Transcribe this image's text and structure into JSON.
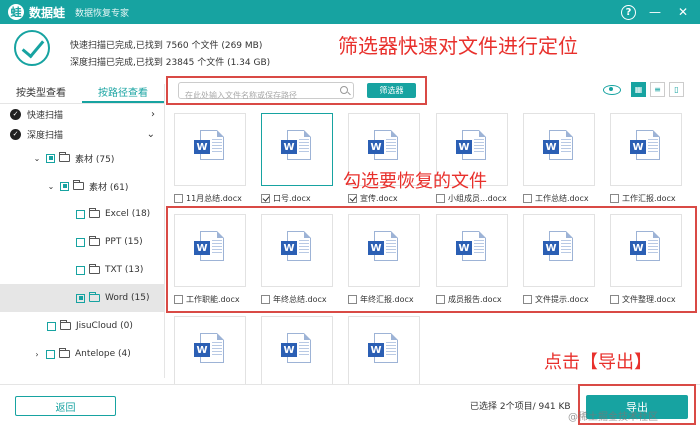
{
  "app": {
    "name": "数据蛙",
    "subtitle": "数据恢复专家",
    "logo_char": "蛙"
  },
  "window_controls": {
    "help": "?",
    "minimize": "—",
    "close": "✕"
  },
  "scan": {
    "quick": "快速扫描已完成,已找到 7560 个文件 (269 MB)",
    "deep": "深度扫描已完成,已找到 23845 个文件 (1.34 GB)"
  },
  "annotations": {
    "filter": "筛选器快速对文件进行定位",
    "check": "勾选要恢复的文件",
    "export": "点击【导出】"
  },
  "left_panel": {
    "tabs": [
      {
        "label": "按类型查看",
        "active": false
      },
      {
        "label": "按路径查看",
        "active": true
      }
    ],
    "scan_nodes": [
      {
        "label": "快速扫描",
        "chevron": "›"
      },
      {
        "label": "深度扫描",
        "chevron": "⌄"
      }
    ],
    "tree": [
      {
        "label": "素材 (75)",
        "caret": "⌄",
        "check": "part"
      },
      {
        "label": "素材 (61)",
        "caret": "⌄",
        "check": "part"
      },
      {
        "label": "Excel (18)",
        "caret": "",
        "check": "none"
      },
      {
        "label": "PPT (15)",
        "caret": "",
        "check": "none"
      },
      {
        "label": "TXT (13)",
        "caret": "",
        "check": "none"
      },
      {
        "label": "Word (15)",
        "caret": "",
        "check": "part"
      },
      {
        "label": "JisuCloud (0)",
        "caret": "",
        "check": "none"
      },
      {
        "label": "Antelope (4)",
        "caret": "›",
        "check": "none"
      }
    ]
  },
  "toolbar": {
    "search_placeholder": "在此处输入文件名称或保存路径",
    "filter_label": "筛选器",
    "view_grid": "▦",
    "view_list": "≡",
    "view_detail": "▯"
  },
  "files": [
    {
      "name": "11月总结.docx",
      "checked": false
    },
    {
      "name": "口号.docx",
      "checked": true
    },
    {
      "name": "宣传.docx",
      "checked": true
    },
    {
      "name": "小组成员...docx",
      "checked": false
    },
    {
      "name": "工作总结.docx",
      "checked": false
    },
    {
      "name": "工作汇报.docx",
      "checked": false
    },
    {
      "name": "工作职能.docx",
      "checked": false
    },
    {
      "name": "年终总结.docx",
      "checked": false
    },
    {
      "name": "年终汇报.docx",
      "checked": false
    },
    {
      "name": "成员报告.docx",
      "checked": false
    },
    {
      "name": "文件提示.docx",
      "checked": false
    },
    {
      "name": "文件整理.docx",
      "checked": false
    },
    {
      "name": "",
      "checked": false
    },
    {
      "name": "",
      "checked": false
    },
    {
      "name": "",
      "checked": false
    }
  ],
  "doc_badge": "W",
  "footer": {
    "back_label": "返回",
    "selected_info": "已选择 2个项目/ 941 KB",
    "export_label": "导出"
  },
  "watermark": "@稀土掘金技术社区",
  "colors": {
    "accent": "#17a3a1",
    "annotation": "#e8302c"
  }
}
